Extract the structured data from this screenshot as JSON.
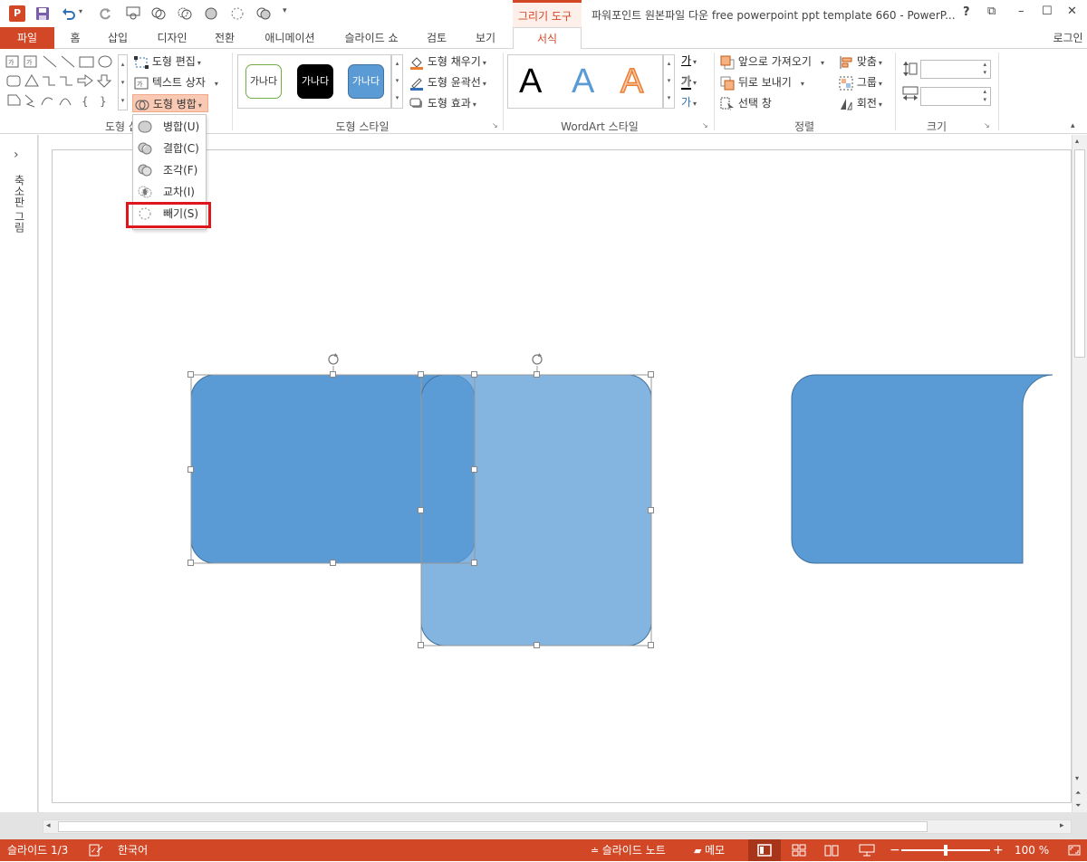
{
  "titlebar": {
    "title": "파워포인트 원본파일 다운 free powerpoint ppt template 660 - PowerP...",
    "context_tab": "그리기 도구",
    "help": "?",
    "restore": "⧉",
    "minimize": "–",
    "maximize": "☐",
    "close": "✕"
  },
  "tabs": {
    "file": "파일",
    "home": "홈",
    "insert": "삽입",
    "design": "디자인",
    "transitions": "전환",
    "animations": "애니메이션",
    "slideshow": "슬라이드 쇼",
    "review": "검토",
    "view": "보기",
    "format": "서식",
    "login": "로그인"
  },
  "ribbon": {
    "insert_shapes": {
      "label": "도형 삽입",
      "edit_shape": "도형 편집",
      "text_box": "텍스트 상자",
      "merge_shapes": "도형 병합"
    },
    "shape_styles": {
      "label": "도형 스타일",
      "sample_text": "가나다",
      "fill": "도형 채우기",
      "outline": "도형 윤곽선",
      "effects": "도형 효과"
    },
    "wordart": {
      "label": "WordArt 스타일",
      "sample": "A",
      "text_fill_glyph": "가"
    },
    "arrange": {
      "label": "정렬",
      "bring_forward": "앞으로 가져오기",
      "send_backward": "뒤로 보내기",
      "selection_pane": "선택 창",
      "align": "맞춤",
      "group": "그룹",
      "rotate": "회전"
    },
    "size": {
      "label": "크기",
      "height_value": "",
      "width_value": ""
    }
  },
  "merge_menu": {
    "items": [
      {
        "label": "병합(U)"
      },
      {
        "label": "결합(C)"
      },
      {
        "label": "조각(F)"
      },
      {
        "label": "교차(I)"
      },
      {
        "label": "빼기(S)"
      }
    ]
  },
  "sidebar": {
    "label": "축소판 그림",
    "expand": "›"
  },
  "status": {
    "slide": "슬라이드 1/3",
    "language": "한국어",
    "notes": "슬라이드 노트",
    "comments": "메모",
    "zoom": "100 %",
    "zoom_level": 0.5
  },
  "colors": {
    "accent": "#d24726",
    "shape_dark": "#5b9bd5",
    "shape_light": "#86b3df",
    "highlight_box": "#e0161d"
  }
}
